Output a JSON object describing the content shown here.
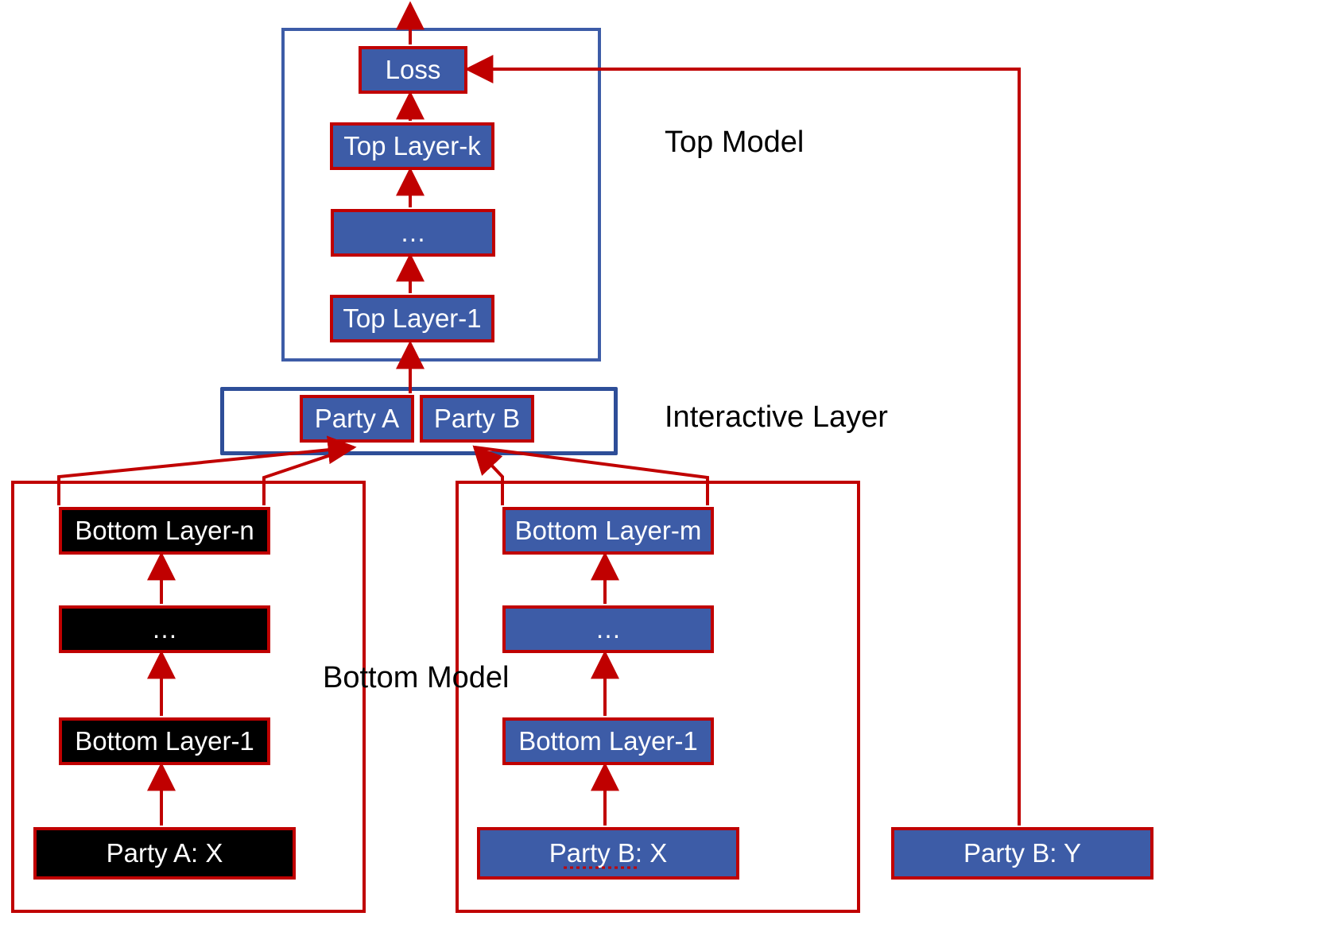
{
  "colors": {
    "blue": "#3d5ca7",
    "black": "#000000",
    "red": "#c00000",
    "groupBlue": "#3d5ca7"
  },
  "labels": {
    "topModel": "Top Model",
    "interactiveLayer": "Interactive Layer",
    "bottomModel": "Bottom Model"
  },
  "top": {
    "loss": "Loss",
    "layerK": "Top Layer-k",
    "ellipsis": "…",
    "layer1": "Top Layer-1"
  },
  "interactive": {
    "a": "Party A",
    "b": "Party B"
  },
  "bottomA": {
    "layerN": "Bottom Layer-n",
    "ellipsis": "…",
    "layer1": "Bottom Layer-1",
    "input": "Party A: X"
  },
  "bottomB": {
    "layerM": "Bottom Layer-m",
    "ellipsis": "…",
    "layer1": "Bottom Layer-1",
    "input": "Party B: X",
    "labels": "Party B: Y"
  }
}
